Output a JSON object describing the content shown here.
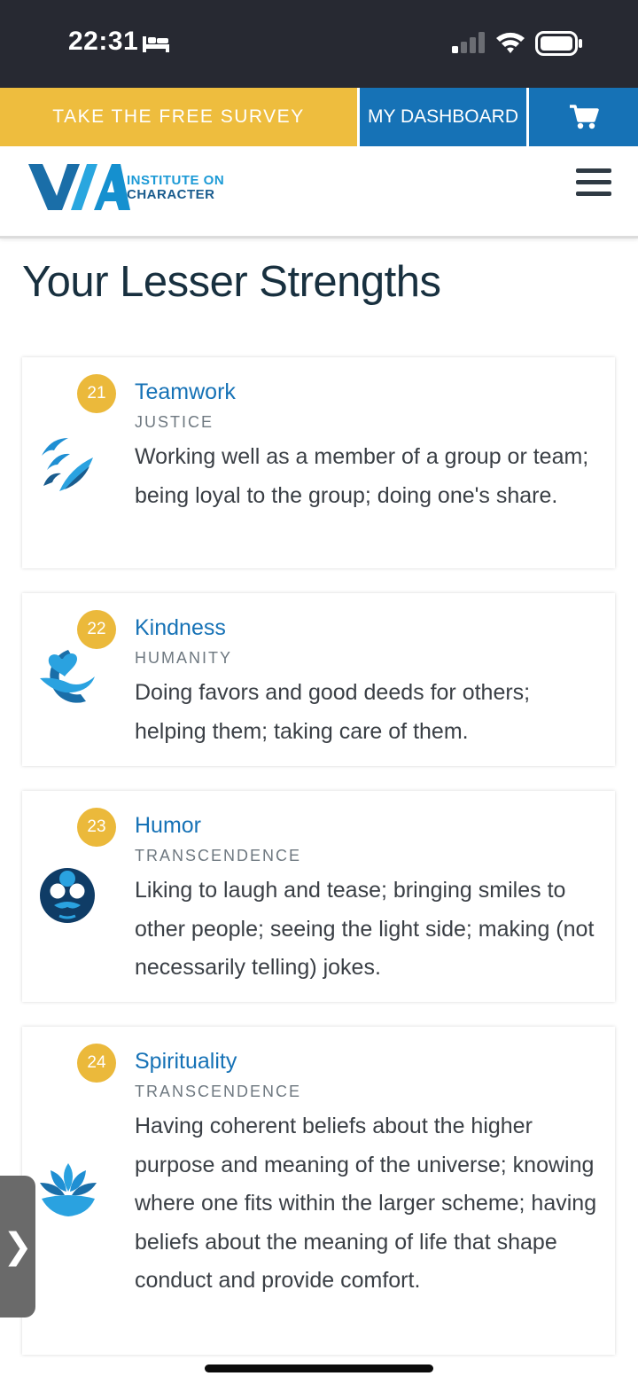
{
  "status_bar": {
    "time": "22:31"
  },
  "top_bar": {
    "survey_label": "TAKE THE FREE SURVEY",
    "dashboard_label": "MY DASHBOARD",
    "cart_icon": "cart-icon"
  },
  "header": {
    "logo_line1": "INSTITUTE ON",
    "logo_line2": "CHARACTER"
  },
  "page": {
    "title": "Your Lesser Strengths"
  },
  "strengths": [
    {
      "rank": "21",
      "name": "Teamwork",
      "category": "JUSTICE",
      "description": "Working well as a member of a group or team; being loyal to the group; doing one's share.",
      "icon": "birds-icon"
    },
    {
      "rank": "22",
      "name": "Kindness",
      "category": "HUMANITY",
      "description": "Doing favors and good deeds for others; helping them; taking care of them.",
      "icon": "heart-hand-icon"
    },
    {
      "rank": "23",
      "name": "Humor",
      "category": "TRANSCENDENCE",
      "description": "Liking to laugh and tease; bringing smiles to other people; seeing the light side; making (not necessarily telling) jokes.",
      "icon": "funny-face-icon"
    },
    {
      "rank": "24",
      "name": "Spirituality",
      "category": "TRANSCENDENCE",
      "description": "Having coherent beliefs about the higher purpose and meaning of the universe; knowing where one fits within the larger scheme; having beliefs about the meaning of life that shape conduct and provide comfort.",
      "icon": "lotus-icon"
    }
  ],
  "side_tab": {
    "label": "❯"
  },
  "colors": {
    "accent_yellow": "#eebd3e",
    "accent_blue": "#1672b6",
    "title_dark": "#18303f",
    "status_bar_bg": "#272932"
  }
}
